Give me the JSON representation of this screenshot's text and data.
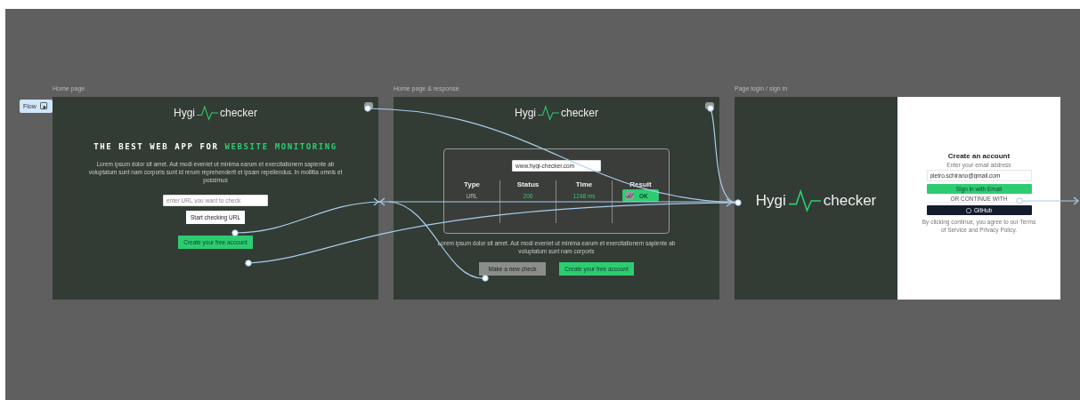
{
  "flow_button": {
    "label": "Flow"
  },
  "frames": [
    {
      "kind": "home",
      "title": "Home page",
      "logo": {
        "left": "Hygi",
        "right": "checker"
      },
      "headline_lead": "THE BEST WEB APP FOR",
      "headline_highlight": "WEBSITE MONITORING",
      "paragraph": "Lorem ipsum dolor sit amet. Aut modi eveniet ut minima earum et exercitationem sapiente ab voluptatum sunt nam corporis sunt id rerum reprehenderit et ipsam repellendus. In mollitia omnis et possimus",
      "url_field": {
        "placeholder": "enter URL you want to check"
      },
      "check_button": "Start checking URL",
      "account_button": "Create your free account"
    },
    {
      "kind": "response",
      "title": "Home page & response",
      "logo": {
        "left": "Hygi",
        "right": "checker"
      },
      "url_field": {
        "value": "www.hygi-checker.com"
      },
      "columns": [
        "Type",
        "Status",
        "Time",
        "Result"
      ],
      "row": {
        "type": "URL",
        "status": "200",
        "time": "1248 ms",
        "result": "OK"
      },
      "paragraph": "Lorem ipsum dolor sit amet. Aut modi eveniet ut minima earum et exercitationem sapiente ab voluptatum sunt nam corporis",
      "new_check_button": "Make a new check",
      "account_button": "Create your free account"
    },
    {
      "kind": "login",
      "title": "Page login / sign in",
      "logo": {
        "left": "Hygi",
        "right": "checker"
      },
      "heading": "Create  an account",
      "hint": "Enter your email address",
      "email_field": {
        "value": "pietro.schirano@gmail.com"
      },
      "sign_in_button": "Sign in with Email",
      "divider": "OR CONTINUE WITH",
      "github_button": "GitHub",
      "terms": "By clicking continue, you agree to our Terms of Service and Privacy Policy."
    }
  ]
}
